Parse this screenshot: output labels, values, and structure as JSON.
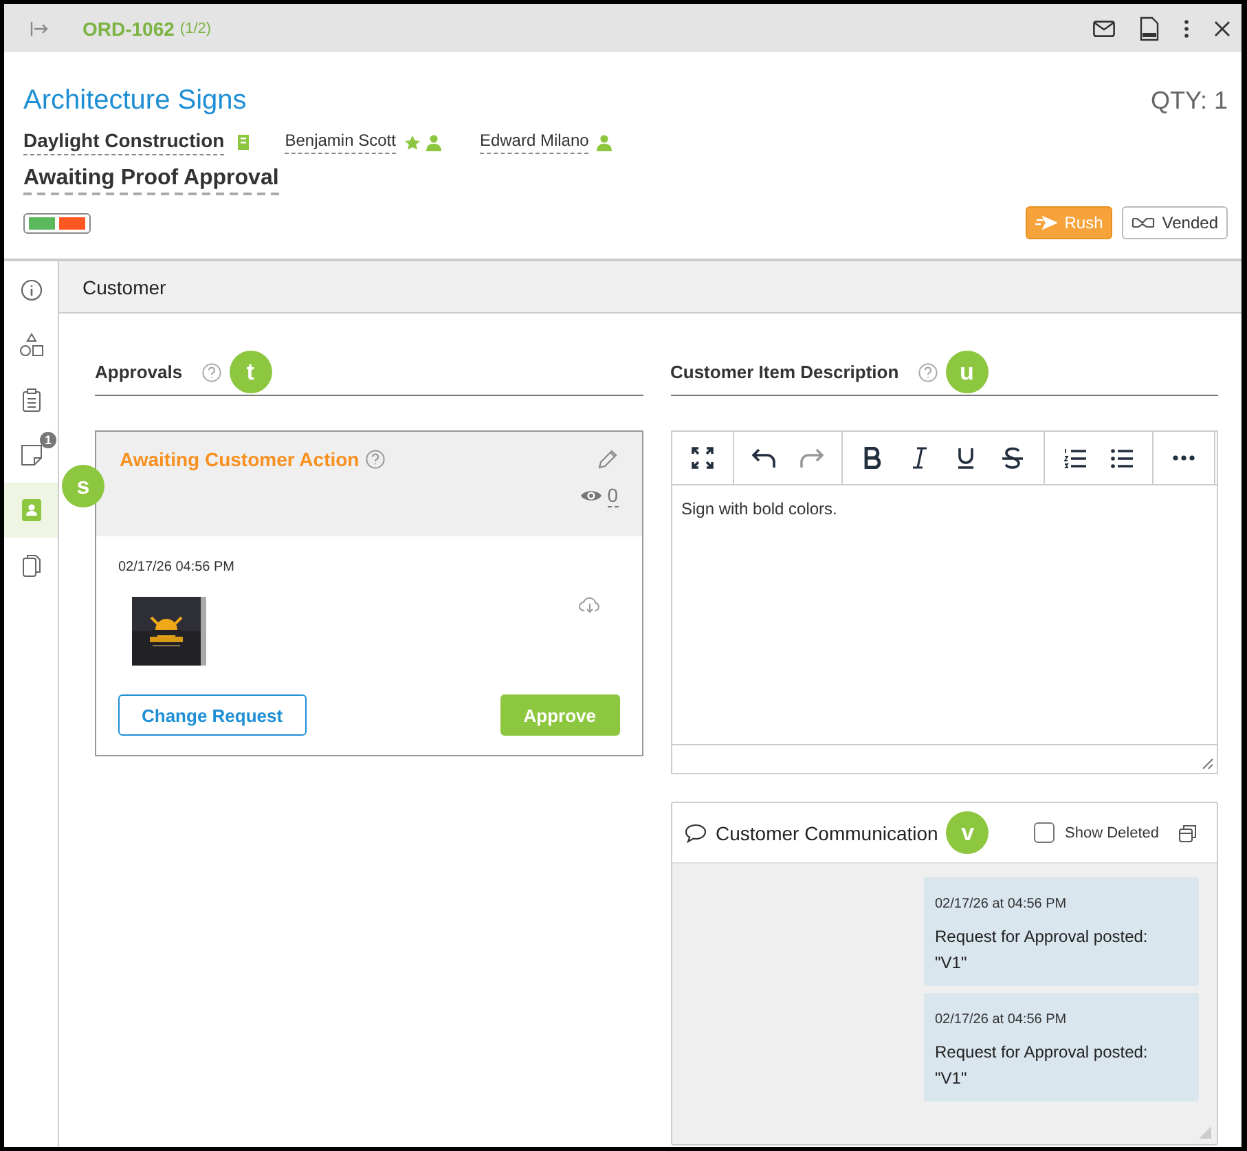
{
  "topbar": {
    "order": "ORD-1062",
    "count": "(1/2)"
  },
  "header": {
    "title": "Architecture Signs",
    "qty": "QTY: 1",
    "customer": "Daylight Construction",
    "contacts": [
      {
        "name": "Benjamin Scott",
        "starred": true
      },
      {
        "name": "Edward Milano",
        "starred": false
      }
    ],
    "status": "Awaiting Proof Approval",
    "swatches": [
      {
        "color": "#5cb85c"
      },
      {
        "color": "#ff5722"
      }
    ],
    "tags": [
      {
        "label": "Rush",
        "kind": "rush"
      },
      {
        "label": "Vended",
        "kind": "vended"
      }
    ]
  },
  "sidebar": {
    "items": [
      {
        "kind": "info",
        "selected": false
      },
      {
        "kind": "shapes",
        "selected": false
      },
      {
        "kind": "clipboard",
        "selected": false
      },
      {
        "kind": "note",
        "selected": false,
        "badge": "1"
      },
      {
        "kind": "contact",
        "selected": true,
        "marker": "s"
      },
      {
        "kind": "copy",
        "selected": false
      }
    ]
  },
  "section": {
    "title": "Customer"
  },
  "approvals": {
    "title": "Approvals",
    "marker": "t",
    "card": {
      "status": "Awaiting Customer Action",
      "views": "0",
      "date": "02/17/26 04:56 PM",
      "buttons": [
        {
          "label": "Change Request",
          "kind": "outline"
        },
        {
          "label": "Approve",
          "kind": "primary"
        }
      ]
    }
  },
  "description": {
    "title": "Customer Item Description",
    "marker": "u",
    "toolbar": [
      [
        {
          "kind": "fullscreen",
          "disabled": false
        }
      ],
      [
        {
          "kind": "undo",
          "disabled": false
        },
        {
          "kind": "redo",
          "disabled": true
        }
      ],
      [
        {
          "kind": "bold",
          "disabled": false
        },
        {
          "kind": "italic",
          "disabled": false
        },
        {
          "kind": "underline",
          "disabled": false
        },
        {
          "kind": "strike",
          "disabled": false
        }
      ],
      [
        {
          "kind": "ordered-list",
          "disabled": false
        },
        {
          "kind": "bullet-list",
          "disabled": false
        }
      ],
      [
        {
          "kind": "more",
          "disabled": false
        }
      ]
    ],
    "text": "Sign with bold colors."
  },
  "communication": {
    "title": "Customer Communication",
    "marker": "v",
    "show_deleted": {
      "label": "Show Deleted",
      "checked": false
    },
    "messages": [
      {
        "time": "02/17/26 at 04:56 PM",
        "text": "Request for Approval posted:\n\"V1\""
      },
      {
        "time": "02/17/26 at 04:56 PM",
        "text": "Request for Approval posted:\n\"V1\""
      }
    ]
  }
}
